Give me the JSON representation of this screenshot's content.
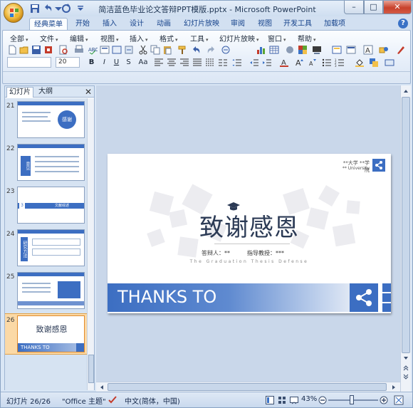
{
  "window": {
    "title": "简洁蓝色毕业论文答辩PPT模版.pptx - Microsoft PowerPoint",
    "minimize": "–",
    "maximize": "□",
    "close": "✕"
  },
  "ribbon_tabs": [
    "经典菜单",
    "开始",
    "插入",
    "设计",
    "动画",
    "幻灯片放映",
    "审阅",
    "视图",
    "开发工具",
    "加载项"
  ],
  "active_tab": "经典菜单",
  "menus": [
    "全部",
    "文件",
    "编辑",
    "视图",
    "插入",
    "格式",
    "工具",
    "幻灯片放映",
    "窗口",
    "帮助"
  ],
  "font": {
    "name_value": "",
    "size_value": "20"
  },
  "format_buttons": [
    "B",
    "I",
    "U",
    "S",
    "Aa"
  ],
  "left_pane": {
    "tabs": [
      "幻灯片",
      "大纲"
    ],
    "close": "✕",
    "thumbnails": [
      {
        "number": "21",
        "text": "感谢"
      },
      {
        "number": "22",
        "text": "意见"
      },
      {
        "number": "23",
        "text": "文献综述"
      },
      {
        "number": "24",
        "text": "研究方法"
      },
      {
        "number": "25",
        "text": ""
      },
      {
        "number": "26",
        "text": "致谢感恩",
        "footer": "THANKS TO"
      }
    ],
    "selected_number": "26"
  },
  "slide": {
    "university": "**大学 **学院",
    "university_en": "** University",
    "title": "致谢感恩",
    "respondent": "答辩人：**",
    "advisor": "指导教授：***",
    "subtitle_en": "The Graduation Thesis Defense",
    "banner": "THANKS TO",
    "accent_color": "#3c6ec2"
  },
  "status": {
    "slide_info": "幻灯片 26/26",
    "theme": "\"Office 主题\"",
    "language": "中文(简体，中国)",
    "zoom": "43%"
  }
}
